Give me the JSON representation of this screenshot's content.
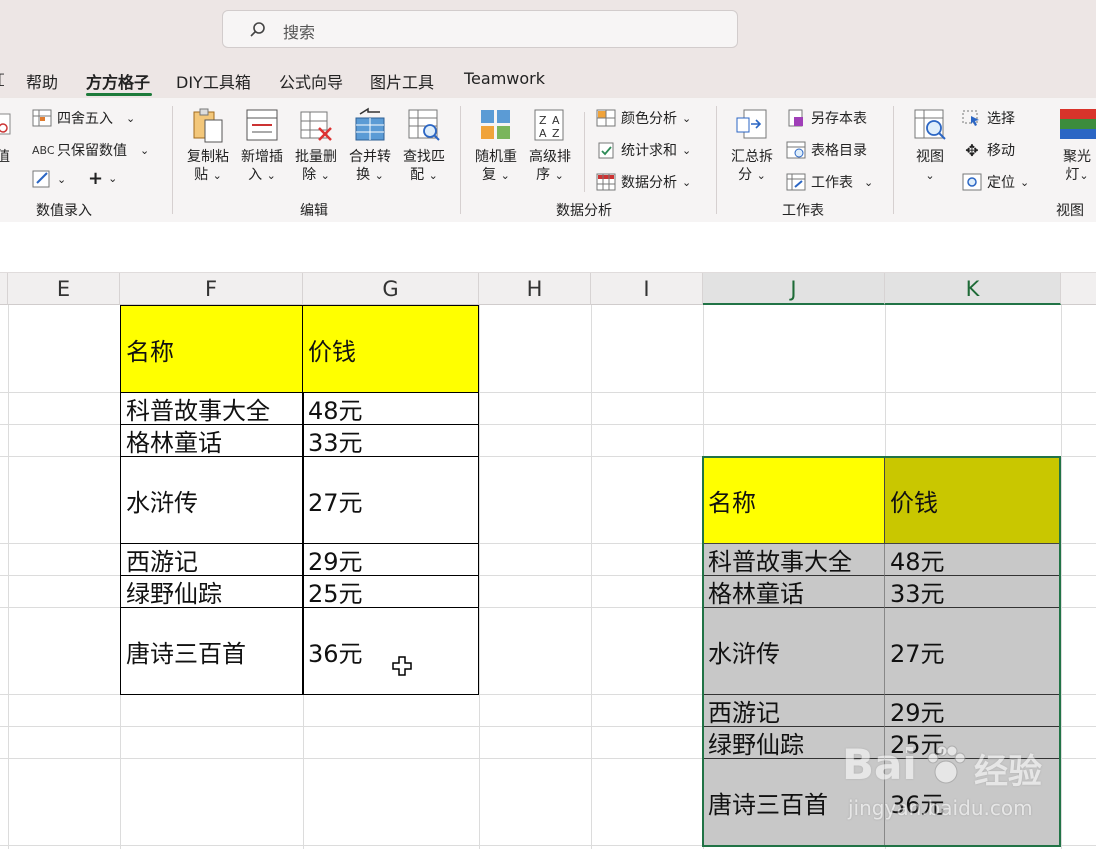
{
  "search": {
    "placeholder": "搜索"
  },
  "tabs": [
    {
      "label": "帮助"
    },
    {
      "label": "方方格子",
      "active": true
    },
    {
      "label": "DIY工具箱"
    },
    {
      "label": "公式向导"
    },
    {
      "label": "图片工具"
    },
    {
      "label": "Teamwork"
    }
  ],
  "ribbon": {
    "values": {
      "round": "四舍五入",
      "keep_values": "只保留数值",
      "left_cut": "值",
      "group": "数值录入"
    },
    "edit": {
      "copy_paste": [
        "复制粘",
        "贴"
      ],
      "insert": [
        "新增插",
        "入"
      ],
      "batch_delete": [
        "批量删",
        "除"
      ],
      "merge": [
        "合并转",
        "换"
      ],
      "find": [
        "查找匹",
        "配"
      ],
      "group": "编辑"
    },
    "analysis": {
      "random": [
        "随机重",
        "复"
      ],
      "sort": [
        "高级排",
        "序"
      ],
      "color": "颜色分析",
      "sum": "统计求和",
      "data": "数据分析",
      "group": "数据分析"
    },
    "sheets": {
      "split": [
        "汇总拆",
        "分"
      ],
      "save_as": "另存本表",
      "catalog": "表格目录",
      "sheet": "工作表",
      "group": "工作表"
    },
    "view": {
      "view": "视图",
      "select": "选择",
      "move": "移动",
      "locate": "定位",
      "spotlight": [
        "聚光",
        "灯"
      ],
      "group": "视图"
    }
  },
  "columns": [
    "E",
    "F",
    "G",
    "H",
    "I",
    "J",
    "K"
  ],
  "table1": {
    "header": [
      "名称",
      "价钱"
    ],
    "rows": [
      [
        "科普故事大全",
        "48元"
      ],
      [
        "格林童话",
        "33元"
      ],
      [
        "水浒传",
        "27元"
      ],
      [
        "西游记",
        "29元"
      ],
      [
        "绿野仙踪",
        "25元"
      ],
      [
        "唐诗三百首",
        "36元"
      ]
    ]
  },
  "table2": {
    "header": [
      "名称",
      "价钱"
    ],
    "rows": [
      [
        "科普故事大全",
        "48元"
      ],
      [
        "格林童话",
        "33元"
      ],
      [
        "水浒传",
        "27元"
      ],
      [
        "西游记",
        "29元"
      ],
      [
        "绿野仙踪",
        "25元"
      ],
      [
        "唐诗三百首",
        "36元"
      ]
    ]
  },
  "watermark": {
    "brand": "Bai",
    "brand2": "经验",
    "url": "jingyan.baidu.com"
  }
}
